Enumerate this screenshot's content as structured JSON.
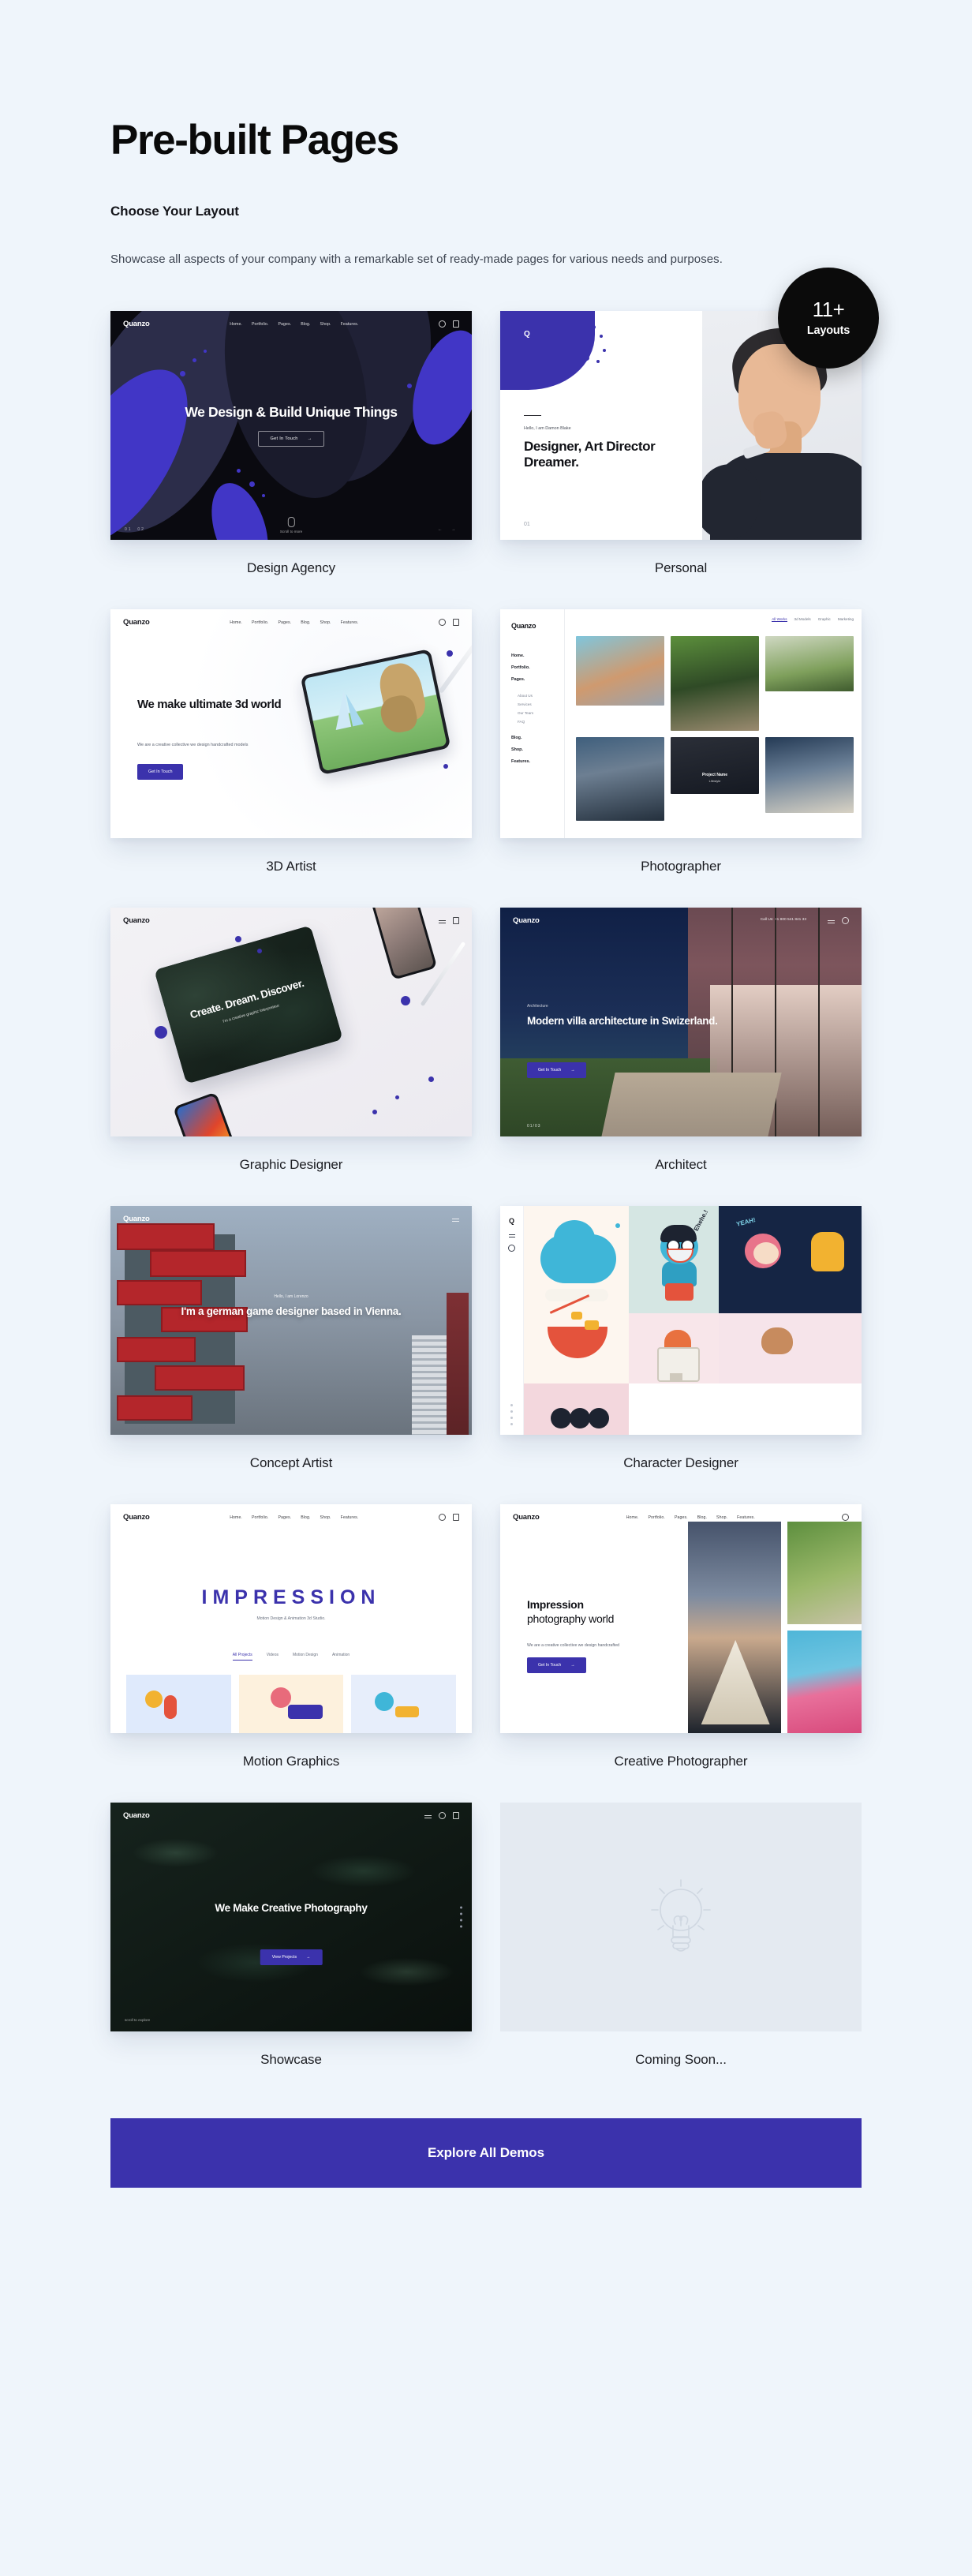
{
  "header": {
    "title": "Pre-built Pages",
    "subtitle": "Choose Your Layout",
    "description": "Showcase all aspects of your company with a remarkable set of ready-made pages for various needs and purposes."
  },
  "badge": {
    "count": "11+",
    "caption": "Layouts"
  },
  "brand": {
    "name": "Quanzo",
    "accent": "#3b32ac",
    "page_bg": "#eff5fb",
    "badge_bg": "#0b0b0b"
  },
  "common_nav": [
    "Home.",
    "Portfolio.",
    "Pages.",
    "Blog.",
    "Shop.",
    "Features."
  ],
  "demos": [
    {
      "label": "Design Agency",
      "logo": "Quanzo",
      "headline": "We Design & Build Unique Things",
      "cta": "Get In Touch",
      "scroll_hint": "Scroll to more",
      "counter": "02",
      "side": "01"
    },
    {
      "label": "Personal",
      "eyebrow": "Hello, I am Damon Blake",
      "headline": "Designer, Art Director Dreamer.",
      "number": "01"
    },
    {
      "label": "3D Artist",
      "logo": "Quanzo",
      "headline": "We make ultimate 3d world",
      "description": "We are a creative collective we design handcrafted models",
      "cta": "Get In Touch"
    },
    {
      "label": "Photographer",
      "logo": "Quanzo",
      "nav": [
        "Home.",
        "Portfolio.",
        "Pages."
      ],
      "subnav": [
        "About Us",
        "Services",
        "Our Team",
        "FAQ"
      ],
      "nav2": [
        "Blog.",
        "Shop.",
        "Features."
      ],
      "filters": [
        "All Works",
        "3d Models",
        "Graphic",
        "Marketing"
      ],
      "caption": "Project Name",
      "caption_sub": "Lifestyle"
    },
    {
      "label": "Graphic Designer",
      "logo": "Quanzo",
      "headline": "Create. Dream. Discover.",
      "description": "I'm a creative graphic interpreteur"
    },
    {
      "label": "Architect",
      "logo": "Quanzo",
      "eyebrow": "Architecture",
      "headline": "Modern villa architecture in Swizerland.",
      "cta": "Get In Touch",
      "phone": "Call Us: +1 800 541 841 33",
      "pager": "01/03"
    },
    {
      "label": "Concept Artist",
      "logo": "Quanzo",
      "eyebrow": "Hello, I am Lorenzo",
      "headline": "I'm a german game designer based in Vienna."
    },
    {
      "label": "Character Designer",
      "logo": "Q",
      "speech": "Ehehe.!",
      "speech2": "YEAH!"
    },
    {
      "label": "Motion Graphics",
      "logo": "Quanzo",
      "headline": "IMPRESSION",
      "description": "Motion Design & Animation 3d Studio.",
      "tabs": [
        "All Projects",
        "Videos",
        "Motion Design",
        "Animation"
      ]
    },
    {
      "label": "Creative Photographer",
      "logo": "Quanzo",
      "headline_bold": "Impression",
      "headline_light": "photography world",
      "description": "We are a creative collective we design handcrafted",
      "cta": "Get In Touch"
    },
    {
      "label": "Showcase",
      "logo": "Quanzo",
      "headline": "We Make Creative Photography",
      "cta": "View Projects"
    },
    {
      "label": "Coming Soon...",
      "icon": "lightbulb-icon"
    }
  ],
  "cta_button": {
    "label": "Explore All Demos"
  }
}
